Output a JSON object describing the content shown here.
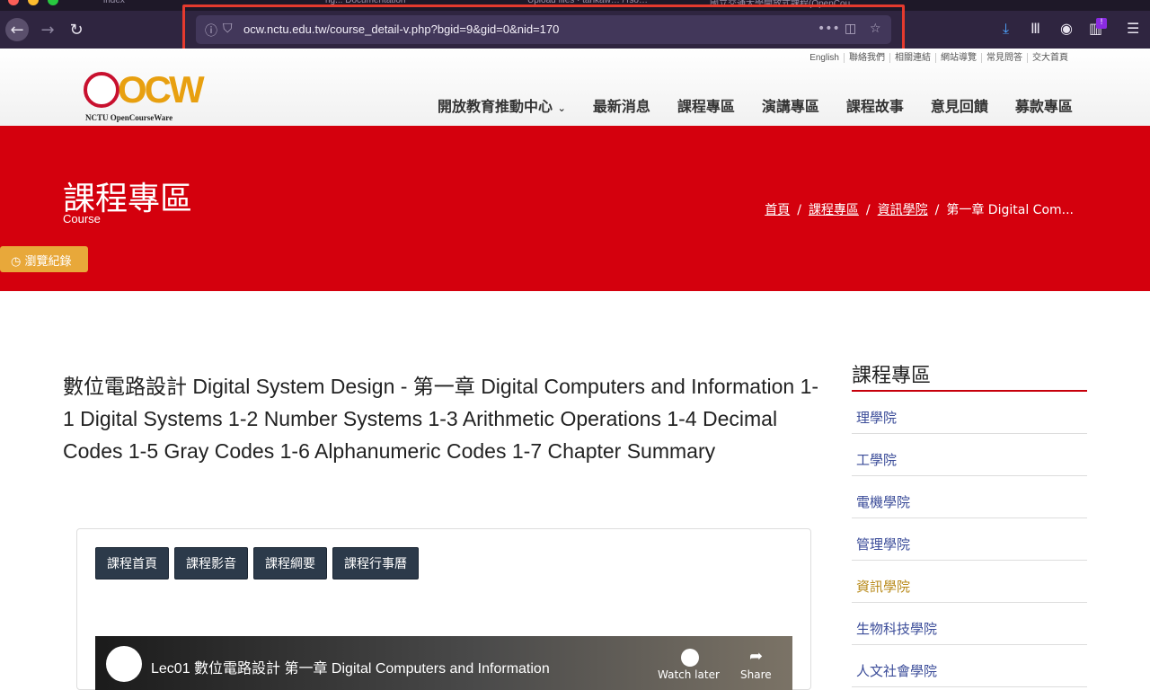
{
  "browser": {
    "tabs": [
      {
        "label": "index"
      },
      {
        "label": "ng... Documentation"
      },
      {
        "label": "Upload files · tankaw… /Tso…"
      },
      {
        "label": "國立交通大學開放式課程(OpenCou…"
      }
    ],
    "url": "ocw.nctu.edu.tw/course_detail-v.php?bgid=9&gid=0&nid=170",
    "notification_badge": "!"
  },
  "header": {
    "toplinks": [
      "English",
      "聯絡我們",
      "相關連結",
      "網站導覽",
      "常見問答",
      "交大首頁"
    ],
    "logo_text": "NCTU OpenCourseWare",
    "logo_main": "OCW",
    "nav": [
      "開放教育推動中心",
      "最新消息",
      "課程專區",
      "演講專區",
      "課程故事",
      "意見回饋",
      "募款專區"
    ]
  },
  "banner": {
    "title": "課程專區",
    "subtitle": "Course",
    "breadcrumb": [
      "首頁",
      "課程專區",
      "資訊學院",
      "第一章 Digital Com..."
    ],
    "history_button": "瀏覽紀錄"
  },
  "content": {
    "title": "數位電路設計 Digital System Design - 第一章 Digital Computers and Information 1-1 Digital Systems 1-2 Number Systems 1-3 Arithmetic Operations 1-4 Decimal Codes 1-5 Gray Codes 1-6 Alphanumeric Codes 1-7 Chapter Summary",
    "tabs": [
      "課程首頁",
      "課程影音",
      "課程綱要",
      "課程行事曆"
    ],
    "video_title": "Lec01 數位電路設計 第一章 Digital Computers and Information",
    "watch_later": "Watch later",
    "share": "Share"
  },
  "sidebar": {
    "title": "課程專區",
    "items": [
      "理學院",
      "工學院",
      "電機學院",
      "管理學院",
      "資訊學院",
      "生物科技學院",
      "人文社會學院"
    ]
  },
  "colors": {
    "brand_red": "#d4000d",
    "nav_dark": "#2c3a4a",
    "history_orange": "#e8a83a"
  }
}
